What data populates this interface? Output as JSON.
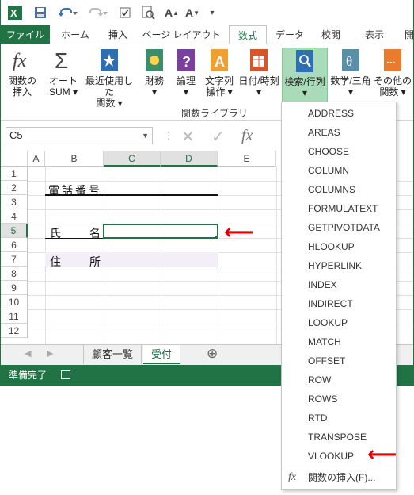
{
  "ribbon": {
    "tabs": [
      "ファイル",
      "ホーム",
      "挿入",
      "ページ レイアウト",
      "数式",
      "データ",
      "校閲",
      "表示",
      "開"
    ],
    "active_tab": "数式",
    "buttons": [
      {
        "icon": "function-fx-icon",
        "line1": "関数の",
        "line2": "挿入"
      },
      {
        "icon": "sigma-icon",
        "line1": "オート",
        "line2": "SUM ▾"
      },
      {
        "icon": "star-book-icon",
        "line1": "最近使用した",
        "line2": "関数 ▾"
      },
      {
        "icon": "finance-book-icon",
        "line1": "財務",
        "line2": "▾"
      },
      {
        "icon": "logic-book-icon",
        "line1": "論理",
        "line2": "▾"
      },
      {
        "icon": "text-book-icon",
        "line1": "文字列",
        "line2": "操作 ▾"
      },
      {
        "icon": "calendar-book-icon",
        "line1": "日付/時刻",
        "line2": "▾"
      },
      {
        "icon": "lookup-book-icon",
        "line1": "検索/行列",
        "line2": "▾"
      },
      {
        "icon": "math-book-icon",
        "line1": "数学/三角",
        "line2": "▾"
      },
      {
        "icon": "more-book-icon",
        "line1": "その他の",
        "line2": "関数 ▾"
      }
    ],
    "group_label": "関数ライブラリ"
  },
  "formula_bar": {
    "name_box": "C5",
    "fx": "fx"
  },
  "grid": {
    "columns": [
      "A",
      "B",
      "C",
      "D",
      "E"
    ],
    "rows": [
      "1",
      "2",
      "3",
      "4",
      "5",
      "6",
      "7",
      "8",
      "9",
      "10",
      "11",
      "12"
    ],
    "cells": {
      "b2": "電話番号",
      "b5_a": "氏",
      "b5_b": "名",
      "b7_a": "住",
      "b7_b": "所"
    }
  },
  "sheets": {
    "tabs": [
      "顧客一覧",
      "受付"
    ],
    "active": "受付",
    "add": "⊕"
  },
  "status": {
    "text": "準備完了"
  },
  "menu": {
    "items": [
      "ADDRESS",
      "AREAS",
      "CHOOSE",
      "COLUMN",
      "COLUMNS",
      "FORMULATEXT",
      "GETPIVOTDATA",
      "HLOOKUP",
      "HYPERLINK",
      "INDEX",
      "INDIRECT",
      "LOOKUP",
      "MATCH",
      "OFFSET",
      "ROW",
      "ROWS",
      "RTD",
      "TRANSPOSE",
      "VLOOKUP"
    ],
    "insert_function": "関数の挿入(F)..."
  },
  "colors": {
    "accent": "#217346",
    "highlight": "#a9dbb8",
    "arrow": "#e00000"
  }
}
